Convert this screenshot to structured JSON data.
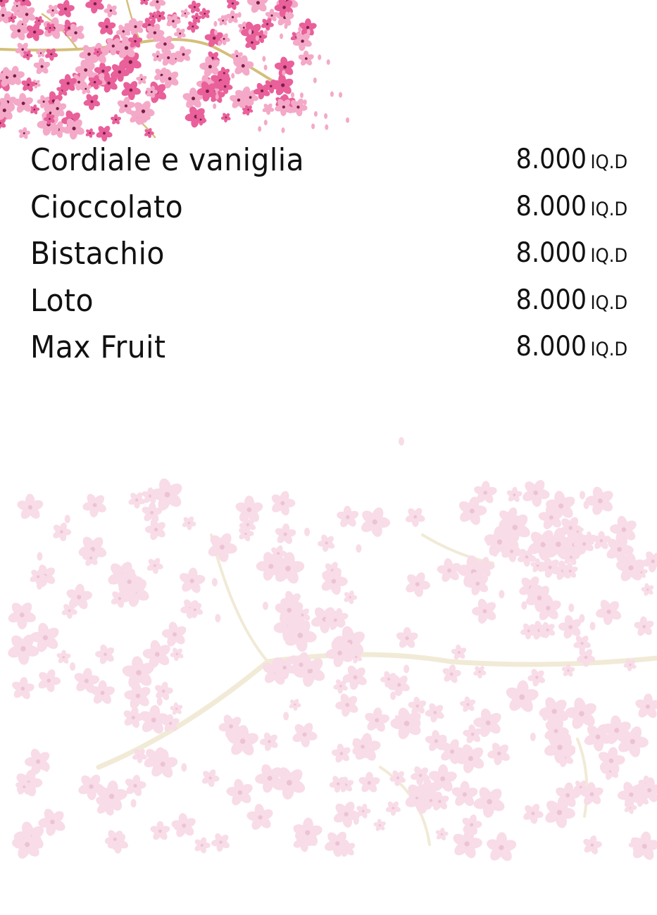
{
  "menu": {
    "items": [
      {
        "name": "Cordiale e vaniglia",
        "price": "8.000",
        "currency": "IQ.D"
      },
      {
        "name": "Cioccolato",
        "price": "8.000",
        "currency": "IQ.D"
      },
      {
        "name": "Bistachio",
        "price": "8.000",
        "currency": "IQ.D"
      },
      {
        "name": "Loto",
        "price": "8.000",
        "currency": "IQ.D"
      },
      {
        "name": "Max Fruit",
        "price": "8.000",
        "currency": "IQ.D"
      }
    ]
  },
  "colors": {
    "blossom": "#e9609a",
    "blossom_light": "#f4a9c8",
    "branch": "#d4bf7a",
    "watermark_blossom": "#f8dce7",
    "watermark_branch": "#f1ead6",
    "text": "#111111"
  },
  "decorations": [
    "cherry-blossom-branch-top",
    "cherry-blossom-watermark-bottom"
  ]
}
